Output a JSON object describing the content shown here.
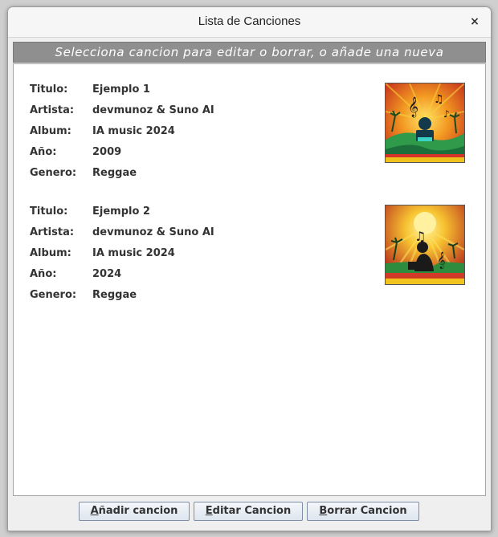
{
  "window": {
    "title": "Lista de Canciones",
    "close_glyph": "×"
  },
  "header": {
    "text": "Selecciona cancion para editar o borrar, o añade una nueva"
  },
  "labels": {
    "titulo": "Titulo:",
    "artista": "Artista:",
    "album": "Album:",
    "anio": "Año:",
    "genero": "Genero:"
  },
  "songs": [
    {
      "titulo": "Ejemplo 1",
      "artista": "devmunoz & Suno AI",
      "album": "IA music 2024",
      "anio": "2009",
      "genero": "Reggae",
      "cover_icon": "album-cover-image"
    },
    {
      "titulo": "Ejemplo 2",
      "artista": "devmunoz & Suno AI",
      "album": "IA music 2024",
      "anio": "2024",
      "genero": "Reggae",
      "cover_icon": "album-cover-image"
    }
  ],
  "buttons": {
    "add_mnemonic": "A",
    "add_rest": "ñadir cancion",
    "edit_mnemonic": "E",
    "edit_rest": "ditar Cancion",
    "delete_mnemonic": "B",
    "delete_rest": "orrar Cancion"
  },
  "colors": {
    "header_bg": "#8f8f8f",
    "button_border": "#7e8ea4"
  }
}
